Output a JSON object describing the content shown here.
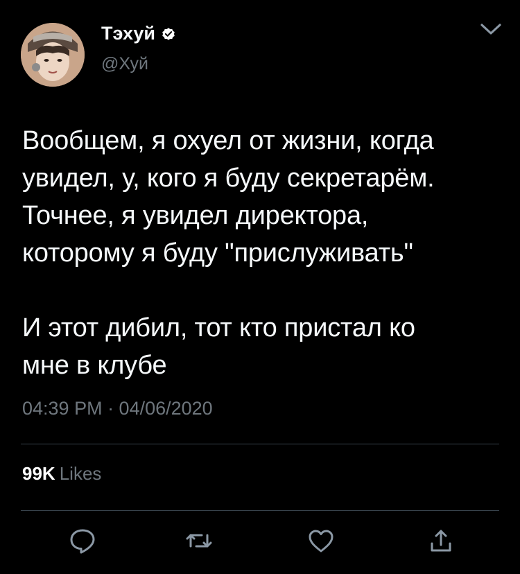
{
  "author": {
    "display_name": "Тэхуй",
    "username": "@Хуй",
    "verified": true,
    "avatar_icon": "user-avatar"
  },
  "tweet": {
    "text": "Вообщем, я охуел от жизни, когда\nувидел, у, кого я буду секретарём.\nТочнее, я увидел директора,\nкоторому я буду \"прислуживать\"\n\nИ этот дибил, тот кто пристал ко\nмне в клубе",
    "timestamp": "04:39 PM · 04/06/2020"
  },
  "stats": {
    "likes_count": "99K",
    "likes_label": "Likes"
  },
  "actions": {
    "reply_icon": "reply-icon",
    "retweet_icon": "retweet-icon",
    "like_icon": "heart-icon",
    "share_icon": "share-icon"
  },
  "colors": {
    "background": "#000000",
    "text": "#f5f8fa",
    "secondary": "#6e767d",
    "divider": "#38444d",
    "verified": "#ffffff"
  }
}
